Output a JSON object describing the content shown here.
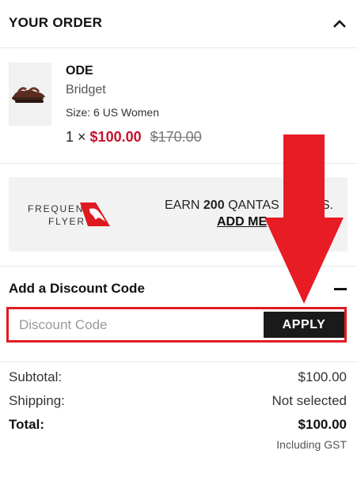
{
  "order": {
    "title": "YOUR ORDER",
    "collapse_icon": "chevron-up-icon"
  },
  "product": {
    "brand": "ODE",
    "name": "Bridget",
    "size": "Size: 6 US Women",
    "quantity_prefix": "1 ×",
    "sale_price": "$100.00",
    "original_price": "$170.00",
    "thumbnail": "brown-sandal-image"
  },
  "frequent_flyer": {
    "logo_line1": "FREQUENT",
    "logo_line2": "FLYER",
    "earn_prefix": "EARN",
    "earn_points": "200",
    "earn_suffix": "QANTAS POINTS.",
    "add_me": "ADD ME"
  },
  "discount": {
    "title": "Add a Discount Code",
    "placeholder": "Discount Code",
    "apply_label": "APPLY",
    "toggle_icon": "minus-icon"
  },
  "totals": {
    "subtotal_label": "Subtotal:",
    "subtotal_value": "$100.00",
    "shipping_label": "Shipping:",
    "shipping_value": "Not selected",
    "total_label": "Total:",
    "total_value": "$100.00",
    "gst_note": "Including GST"
  },
  "colors": {
    "sale_red": "#c8102e",
    "highlight_red": "#e01b22",
    "button_dark": "#1a1a1a",
    "panel_grey": "#f2f2f2"
  }
}
